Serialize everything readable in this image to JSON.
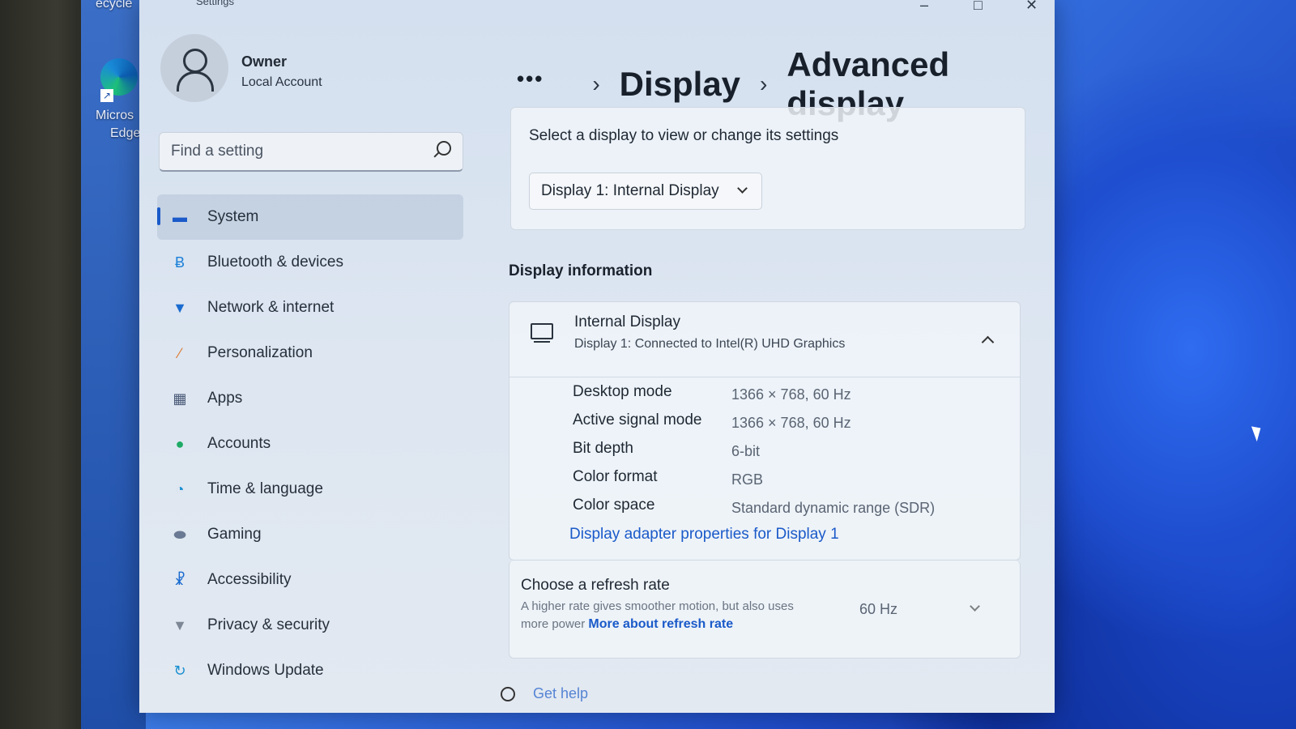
{
  "desktop": {
    "recycle_label": "ecycle",
    "edge_label_1": "Micros",
    "edge_label_2": "Edge"
  },
  "window": {
    "title": "Settings",
    "controls": {
      "minimize": "–",
      "maximize": "□",
      "close": "✕"
    }
  },
  "profile": {
    "name": "Owner",
    "account_type": "Local Account"
  },
  "search": {
    "placeholder": "Find a setting"
  },
  "sidebar": {
    "items": [
      {
        "label": "System",
        "icon": "monitor-icon",
        "color": "#1a5ac9",
        "active": true
      },
      {
        "label": "Bluetooth & devices",
        "icon": "bluetooth-icon",
        "color": "#1a7fd8",
        "active": false
      },
      {
        "label": "Network & internet",
        "icon": "wifi-icon",
        "color": "#1a6bd0",
        "active": false
      },
      {
        "label": "Personalization",
        "icon": "brush-icon",
        "color": "#e07a2e",
        "active": false
      },
      {
        "label": "Apps",
        "icon": "apps-icon",
        "color": "#4a5a78",
        "active": false
      },
      {
        "label": "Accounts",
        "icon": "person-icon",
        "color": "#1eaa66",
        "active": false
      },
      {
        "label": "Time & language",
        "icon": "globe-clock-icon",
        "color": "#1a8fd0",
        "active": false
      },
      {
        "label": "Gaming",
        "icon": "gamepad-icon",
        "color": "#6a7a94",
        "active": false
      },
      {
        "label": "Accessibility",
        "icon": "accessibility-icon",
        "color": "#1a6bd0",
        "active": false
      },
      {
        "label": "Privacy & security",
        "icon": "shield-icon",
        "color": "#7d8796",
        "active": false
      },
      {
        "label": "Windows Update",
        "icon": "update-icon",
        "color": "#1a8fd0",
        "active": false
      }
    ]
  },
  "breadcrumb": {
    "more": "•••",
    "parent": "Display",
    "current": "Advanced display"
  },
  "display_select": {
    "prompt": "Select a display to view or change its settings",
    "selected": "Display 1: Internal Display"
  },
  "display_info": {
    "section_title": "Display information",
    "title": "Internal Display",
    "subtitle": "Display 1: Connected to Intel(R) UHD Graphics",
    "rows": [
      {
        "label": "Desktop mode",
        "value": "1366 × 768, 60 Hz"
      },
      {
        "label": "Active signal mode",
        "value": "1366 × 768, 60 Hz"
      },
      {
        "label": "Bit depth",
        "value": "6-bit"
      },
      {
        "label": "Color format",
        "value": "RGB"
      },
      {
        "label": "Color space",
        "value": "Standard dynamic range (SDR)"
      }
    ],
    "adapter_link": "Display adapter properties for Display 1"
  },
  "refresh_rate": {
    "title": "Choose a refresh rate",
    "description": "A higher rate gives smoother motion, but also uses more power",
    "link": "More about refresh rate",
    "selected": "60 Hz"
  },
  "help": {
    "label": "Get help"
  }
}
